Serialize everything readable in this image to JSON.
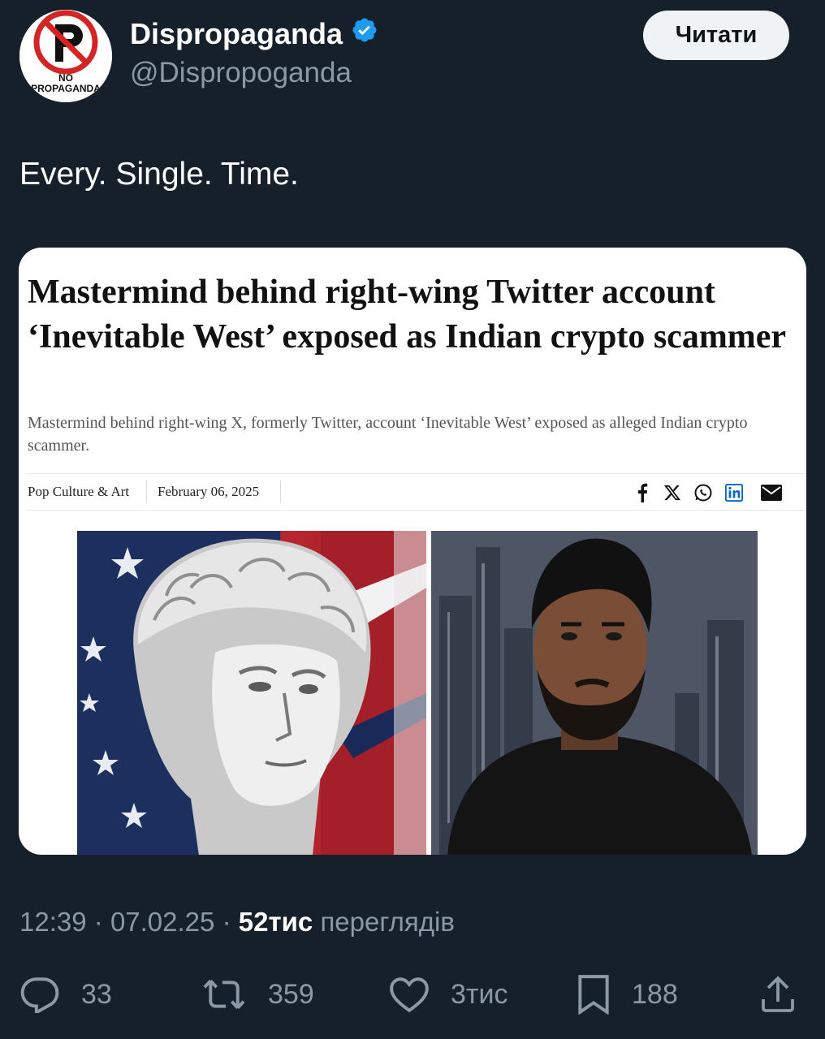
{
  "author": {
    "display_name": "Dispropaganda",
    "handle": "@Dispropoganda",
    "verified": true,
    "avatar_text_line1": "NO",
    "avatar_text_line2": "PROPAGANDA"
  },
  "follow_button_label": "Читати",
  "tweet_text": "Every. Single. Time.",
  "article": {
    "headline": "Mastermind behind right-wing Twitter account ‘Inevitable West’ exposed as Indian crypto scammer",
    "subheadline": "Mastermind behind right-wing X, formerly Twitter, account ‘Inevitable West’ exposed as alleged Indian crypto scammer.",
    "category": "Pop Culture & Art",
    "date": "February 06, 2025",
    "share_icons": [
      "facebook-icon",
      "x-icon",
      "whatsapp-icon",
      "linkedin-icon",
      "mail-icon"
    ]
  },
  "meta": {
    "time": "12:39",
    "date": "07.02.25",
    "views_count": "52тис",
    "views_label": "переглядів"
  },
  "actions": {
    "replies": "33",
    "reposts": "359",
    "likes": "3тис",
    "bookmarks": "188"
  },
  "colors": {
    "background": "#15202b",
    "verified_badge": "#1d9bf0",
    "secondary_text": "#8b98a5",
    "follow_button_bg": "#eff3f4"
  }
}
